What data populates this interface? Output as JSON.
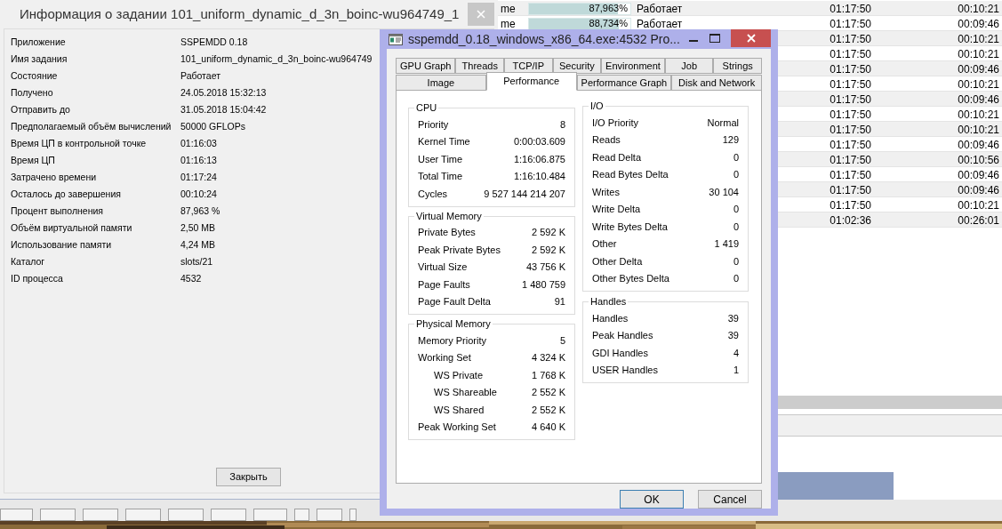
{
  "task_list": {
    "rows": [
      {
        "column_1": "me",
        "progress": {
          "level": 0.87963,
          "text": "87,963%"
        },
        "status": "Работает",
        "elapsed": "01:17:50",
        "remaining": "00:10:21"
      },
      {
        "column_1": "me",
        "progress": {
          "level": 0.88734,
          "text": "88,734%"
        },
        "status": "Работает",
        "elapsed": "01:17:50",
        "remaining": "00:09:46"
      },
      {
        "elapsed": "01:17:50",
        "remaining": "00:10:21"
      },
      {
        "elapsed": "01:17:50",
        "remaining": "00:10:21"
      },
      {
        "elapsed": "01:17:50",
        "remaining": "00:09:46"
      },
      {
        "elapsed": "01:17:50",
        "remaining": "00:10:21"
      },
      {
        "elapsed": "01:17:50",
        "remaining": "00:09:46"
      },
      {
        "elapsed": "01:17:50",
        "remaining": "00:10:21"
      },
      {
        "elapsed": "01:17:50",
        "remaining": "00:10:21"
      },
      {
        "elapsed": "01:17:50",
        "remaining": "00:09:46"
      },
      {
        "elapsed": "01:17:50",
        "remaining": "00:10:56"
      },
      {
        "elapsed": "01:17:50",
        "remaining": "00:09:46"
      },
      {
        "elapsed": "01:17:50",
        "remaining": "00:09:46"
      },
      {
        "elapsed": "01:17:50",
        "remaining": "00:10:21"
      },
      {
        "elapsed": "01:02:36",
        "remaining": "00:26:01"
      }
    ]
  },
  "task_dialog": {
    "title": "Информация о задании 101_uniform_dynamic_d_3n_boinc-wu964749_1",
    "fields": [
      {
        "label": "Приложение",
        "value": "SSPEMDD 0.18"
      },
      {
        "label": "Имя задания",
        "value": "101_uniform_dynamic_d_3n_boinc-wu964749"
      },
      {
        "label": "Состояние",
        "value": "Работает"
      },
      {
        "label": "Получено",
        "value": "24.05.2018 15:32:13"
      },
      {
        "label": "Отправить до",
        "value": "31.05.2018 15:04:42"
      },
      {
        "label": "Предполагаемый объём вычислений",
        "value": "50000 GFLOPs"
      },
      {
        "label": "Время ЦП в контрольной точке",
        "value": "01:16:03"
      },
      {
        "label": "Время ЦП",
        "value": "01:16:13"
      },
      {
        "label": "Затрачено времени",
        "value": "01:17:24"
      },
      {
        "label": "Осталось до завершения",
        "value": "00:10:24"
      },
      {
        "label": "Процент выполнения",
        "value": "87,963 %"
      },
      {
        "label": "Объём виртуальной памяти",
        "value": "2,50 MB"
      },
      {
        "label": "Использование памяти",
        "value": "4,24 MB"
      },
      {
        "label": "Каталог",
        "value": "slots/21"
      },
      {
        "label": "ID процесса",
        "value": "4532"
      }
    ],
    "close_button": "Закрыть"
  },
  "process_window": {
    "title": "sspemdd_0.18_windows_x86_64.exe:4532 Pro...",
    "tabs_row_1": [
      {
        "label": "GPU Graph",
        "selected": false
      },
      {
        "label": "Threads",
        "selected": false
      },
      {
        "label": "TCP/IP",
        "selected": false
      },
      {
        "label": "Security",
        "selected": false
      },
      {
        "label": "Environment",
        "selected": false
      },
      {
        "label": "Job",
        "selected": false
      },
      {
        "label": "Strings",
        "selected": false
      }
    ],
    "tabs_row_2": [
      {
        "label": "Image",
        "selected": false
      },
      {
        "label": "Performance",
        "selected": true
      },
      {
        "label": "Performance Graph",
        "selected": false
      },
      {
        "label": "Disk and Network",
        "selected": false
      }
    ],
    "left_groups": [
      {
        "title": "CPU",
        "rows": [
          {
            "label": "Priority",
            "value": "8"
          },
          {
            "label": "Kernel Time",
            "value": "0:00:03.609"
          },
          {
            "label": "User Time",
            "value": "1:16:06.875"
          },
          {
            "label": "Total Time",
            "value": "1:16:10.484"
          },
          {
            "label": "Cycles",
            "value": "9 527 144 214 207"
          }
        ]
      },
      {
        "title": "Virtual Memory",
        "rows": [
          {
            "label": "Private Bytes",
            "value": "2 592 K"
          },
          {
            "label": "Peak Private Bytes",
            "value": "2 592 K"
          },
          {
            "label": "Virtual Size",
            "value": "43 756 K"
          },
          {
            "label": "Page Faults",
            "value": "1 480 759"
          },
          {
            "label": "Page Fault Delta",
            "value": "91"
          }
        ]
      },
      {
        "title": "Physical Memory",
        "rows": [
          {
            "label": "Memory Priority",
            "value": "5"
          },
          {
            "label": "Working Set",
            "value": "4 324 K",
            "children": [
              {
                "label": "WS Private",
                "value": "1 768 K"
              },
              {
                "label": "WS Shareable",
                "value": "2 552 K"
              },
              {
                "label": "WS Shared",
                "value": "2 552 K"
              }
            ]
          },
          {
            "label": "Peak Working Set",
            "value": "4 640 K"
          }
        ]
      }
    ],
    "right_groups": [
      {
        "title": "I/O",
        "rows": [
          {
            "label": "I/O Priority",
            "value": "Normal"
          },
          {
            "label": "Reads",
            "value": "129"
          },
          {
            "label": "Read Delta",
            "value": "0"
          },
          {
            "label": "Read Bytes Delta",
            "value": "0"
          },
          {
            "label": "Writes",
            "value": "30 104"
          },
          {
            "label": "Write Delta",
            "value": "0"
          },
          {
            "label": "Write Bytes Delta",
            "value": "0"
          },
          {
            "label": "Other",
            "value": "1 419"
          },
          {
            "label": "Other Delta",
            "value": "0"
          },
          {
            "label": "Other Bytes Delta",
            "value": "0"
          }
        ]
      },
      {
        "title": "Handles",
        "rows": [
          {
            "label": "Handles",
            "value": "39"
          },
          {
            "label": "Peak Handles",
            "value": "39"
          },
          {
            "label": "GDI Handles",
            "value": "4"
          },
          {
            "label": "USER Handles",
            "value": "1"
          }
        ]
      }
    ],
    "buttons": [
      {
        "label": "OK",
        "selected": true
      },
      {
        "label": "Cancel",
        "selected": false
      }
    ]
  }
}
